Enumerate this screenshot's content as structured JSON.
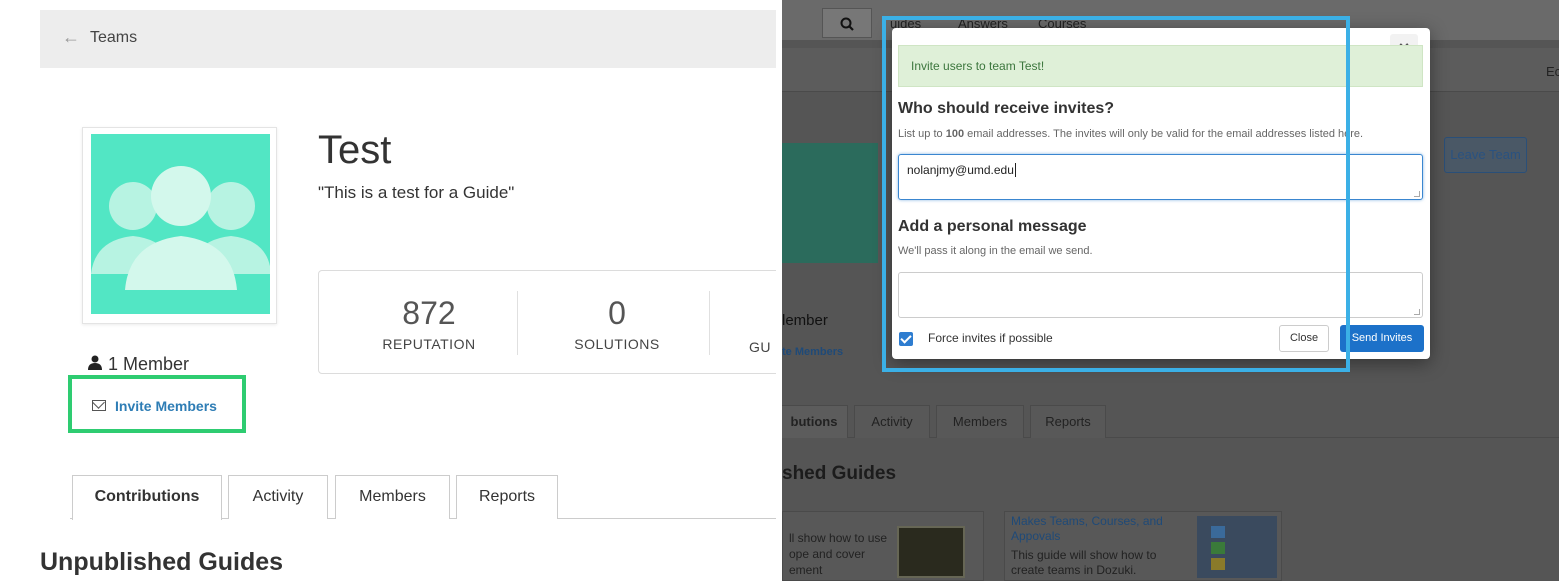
{
  "left": {
    "breadcrumb": {
      "back_label": "Teams"
    },
    "team": {
      "title": "Test",
      "description": "\"This is a test for a Guide\""
    },
    "stats": [
      {
        "value": "872",
        "label": "REPUTATION"
      },
      {
        "value": "0",
        "label": "SOLUTIONS"
      },
      {
        "value": "",
        "label": "GU"
      }
    ],
    "members": {
      "count_label": "1 Member",
      "invite_label": "Invite Members"
    },
    "tabs": [
      "Contributions",
      "Activity",
      "Members",
      "Reports"
    ],
    "section_heading": "Unpublished Guides"
  },
  "right": {
    "nav": {
      "items": [
        "uides",
        "Answers",
        "Courses"
      ],
      "edge_text": "Ec"
    },
    "leave_button": "Leave Team",
    "member_partial": "lember",
    "invite_partial": "te Members",
    "tabs": [
      "butions",
      "Activity",
      "Members",
      "Reports"
    ],
    "section_heading": "shed Guides",
    "card1": {
      "text_lines": [
        "ll show how to use",
        "ope and cover",
        "ement"
      ]
    },
    "card2": {
      "title": "Makes Teams, Courses, and Appovals",
      "description": "This guide will show how to create teams in Dozuki."
    },
    "modal": {
      "close_icon": "×",
      "alert": "Invite users to team Test!",
      "heading_invites": "Who should receive invites?",
      "invite_help_prefix": "List up to ",
      "invite_help_count": "100",
      "invite_help_suffix": " email addresses. The invites will only be valid for the email addresses listed here.",
      "emails_value": "nolanjmy@umd.edu",
      "heading_message": "Add a personal message",
      "message_help": "We'll pass it along in the email we send.",
      "message_value": "",
      "force_label": "Force invites if possible",
      "force_checked": true,
      "close_button": "Close",
      "send_button": "Send Invites"
    }
  },
  "colors": {
    "highlight_green": "#2ecc71",
    "highlight_blue": "#3bb0e6",
    "avatar_teal": "#52e6c4",
    "link_blue": "#2e7db5",
    "primary_button": "#1c71c9"
  }
}
